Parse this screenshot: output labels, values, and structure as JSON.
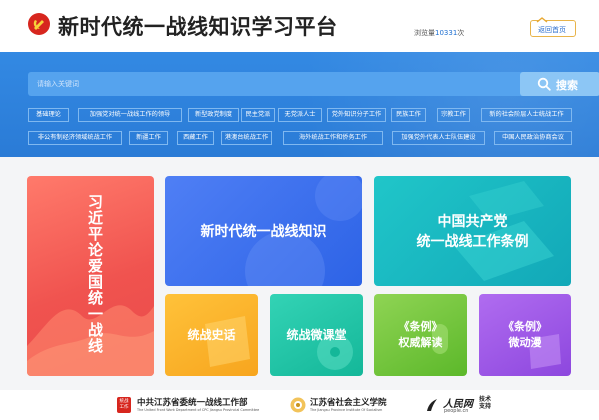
{
  "header": {
    "title": "新时代统一战线知识学习平台",
    "views_label": "浏览量",
    "views_count": "10331",
    "views_unit": "次",
    "home_label": "返回首页"
  },
  "search": {
    "placeholder": "请输入关键词",
    "button_label": "搜索"
  },
  "tags": [
    "基础理论",
    "加强党对统一战线工作的领导",
    "新型政党制度",
    "民主党派",
    "无党派人士",
    "党外知识分子工作",
    "民族工作",
    "宗教工作",
    "新的社会阶层人士统战工作",
    "非公有制经济领域统战工作",
    "新疆工作",
    "西藏工作",
    "港澳台统战工作",
    "海外统战工作和侨务工作",
    "加强党外代表人士队伍建设",
    "中国人民政治协商会议"
  ],
  "cards": {
    "vertical": "习近平论爱国统一战线",
    "knowledge": "新时代统一战线知识",
    "rules_line1": "中国共产党",
    "rules_line2": "统一战线工作条例",
    "history": "统战史话",
    "micro": "统战微课堂",
    "authority_line1": "《条例》",
    "authority_line2": "权威解读",
    "anime_line1": "《条例》",
    "anime_line2": "微动漫"
  },
  "footer": {
    "org1_badge_top": "统战",
    "org1_badge_bottom": "工作",
    "org1_name": "中共江苏省委统一战线工作部",
    "org1_sub": "The United Front Work Department of CPC Jiangsu Provincial Committee",
    "org2_name": "江苏省社会主义学院",
    "org2_sub": "The Jiangsu Province Institute Of Socialism",
    "org3_name": "人民网",
    "org3_domain": "people.cn",
    "org3_support": "技术支持"
  },
  "colors": {
    "brand_blue": "#2e82de",
    "accent_red": "#f0534f",
    "title_text": "#222222",
    "view_count": "#1e6fd1"
  }
}
